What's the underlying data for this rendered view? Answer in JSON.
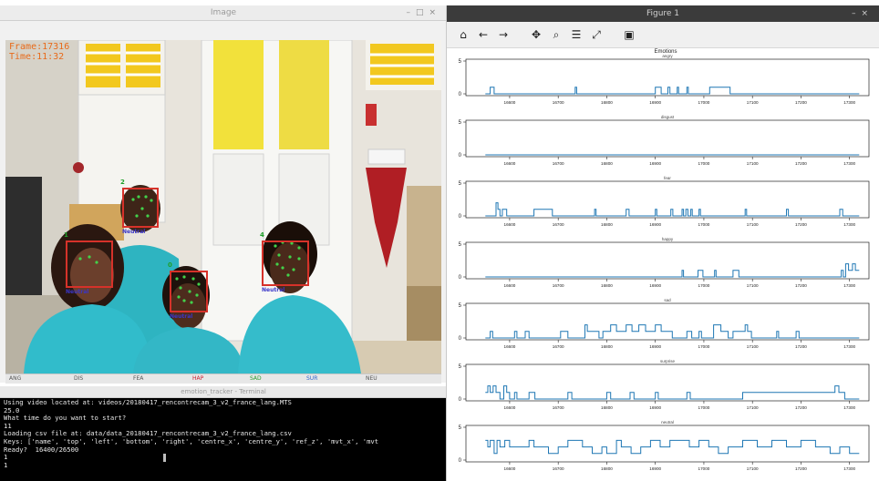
{
  "video_window": {
    "title": "Image",
    "overlay": {
      "frame": "Frame:17316",
      "time": "Time:11:32"
    },
    "face_labels": [
      "Neutral",
      "Neutral",
      "Neutral",
      "Neutral"
    ],
    "face_ids": [
      "2",
      "1",
      "0",
      "4"
    ],
    "trackbar": {
      "labels": [
        "ANG",
        "DIS",
        "FEA",
        "HAP",
        "SAD",
        "SUR",
        "NEU"
      ]
    }
  },
  "terminal_window": {
    "title": "emotion_tracker - Terminal",
    "lines": [
      "Using video located at: videos/20180417_rencontrecam_3_v2_france_lang.MTS",
      "25.0",
      "What time do you want to start?",
      "11",
      "Loading csv file at: data/data_20180417_rencontrecam_3_v2_france_lang.csv",
      "Keys: ['name', 'top', 'left', 'bottom', 'right', 'centre_x', 'centre_y', 'ref_z', 'mvt_x', 'mvt",
      "Ready?  16400/26500",
      "1",
      "1"
    ]
  },
  "figure_window": {
    "title": "Figure 1",
    "toolbar": [
      "home-icon",
      "back-arrow-icon",
      "forward-arrow-icon",
      "pan-icon",
      "zoom-icon",
      "configure-subplots-icon",
      "edit-axis-icon",
      "save-icon"
    ],
    "suptitle": "Emotions"
  },
  "chart_data": {
    "type": "line",
    "title": "Emotions",
    "xlim": [
      16510,
      17340
    ],
    "ylim": [
      0,
      5
    ],
    "yticks": [
      0,
      5
    ],
    "xticks": [
      16600,
      16700,
      16800,
      16900,
      17000,
      17100,
      17200,
      17300
    ],
    "xticklabels": [
      "16600",
      "16700",
      "16800",
      "16900",
      "17000",
      "17100",
      "17200",
      "17300"
    ],
    "series_color": "#1f77b4",
    "x_start": 16550,
    "x_end": 17320,
    "series": [
      {
        "name": "angry",
        "segments": [
          [
            16550,
            16560,
            0
          ],
          [
            16560,
            16568,
            1
          ],
          [
            16568,
            16735,
            0
          ],
          [
            16735,
            16738,
            1
          ],
          [
            16738,
            16900,
            0
          ],
          [
            16900,
            16912,
            1
          ],
          [
            16912,
            16926,
            0
          ],
          [
            16926,
            16930,
            1
          ],
          [
            16930,
            16945,
            0
          ],
          [
            16945,
            16948,
            1
          ],
          [
            16948,
            16965,
            0
          ],
          [
            16965,
            16968,
            1
          ],
          [
            16968,
            17012,
            0
          ],
          [
            17012,
            17054,
            1
          ],
          [
            17054,
            17320,
            0
          ]
        ]
      },
      {
        "name": "disgust",
        "segments": [
          [
            16550,
            17320,
            0
          ]
        ]
      },
      {
        "name": "fear",
        "segments": [
          [
            16550,
            16572,
            0
          ],
          [
            16572,
            16576,
            2
          ],
          [
            16576,
            16580,
            1
          ],
          [
            16580,
            16585,
            0
          ],
          [
            16585,
            16594,
            1
          ],
          [
            16594,
            16650,
            0
          ],
          [
            16650,
            16688,
            1
          ],
          [
            16688,
            16775,
            0
          ],
          [
            16775,
            16778,
            1
          ],
          [
            16778,
            16840,
            0
          ],
          [
            16840,
            16846,
            1
          ],
          [
            16846,
            16900,
            0
          ],
          [
            16900,
            16903,
            1
          ],
          [
            16903,
            16932,
            0
          ],
          [
            16932,
            16936,
            1
          ],
          [
            16936,
            16955,
            0
          ],
          [
            16955,
            16958,
            1
          ],
          [
            16958,
            16963,
            0
          ],
          [
            16963,
            16967,
            1
          ],
          [
            16967,
            16973,
            0
          ],
          [
            16973,
            16976,
            1
          ],
          [
            16976,
            16990,
            0
          ],
          [
            16990,
            16993,
            1
          ],
          [
            16993,
            17085,
            0
          ],
          [
            17085,
            17088,
            1
          ],
          [
            17088,
            17170,
            0
          ],
          [
            17170,
            17174,
            1
          ],
          [
            17174,
            17280,
            0
          ],
          [
            17280,
            17286,
            1
          ],
          [
            17286,
            17320,
            0
          ]
        ]
      },
      {
        "name": "happy",
        "segments": [
          [
            16550,
            16955,
            0
          ],
          [
            16955,
            16958,
            1
          ],
          [
            16958,
            16988,
            0
          ],
          [
            16988,
            16998,
            1
          ],
          [
            16998,
            17022,
            0
          ],
          [
            17022,
            17025,
            1
          ],
          [
            17025,
            17060,
            0
          ],
          [
            17060,
            17072,
            1
          ],
          [
            17072,
            17283,
            0
          ],
          [
            17283,
            17287,
            1
          ],
          [
            17287,
            17292,
            0
          ],
          [
            17292,
            17298,
            2
          ],
          [
            17298,
            17306,
            1
          ],
          [
            17306,
            17312,
            2
          ],
          [
            17312,
            17320,
            1
          ]
        ]
      },
      {
        "name": "sad",
        "segments": [
          [
            16550,
            16560,
            0
          ],
          [
            16560,
            16565,
            1
          ],
          [
            16565,
            16610,
            0
          ],
          [
            16610,
            16615,
            1
          ],
          [
            16615,
            16632,
            0
          ],
          [
            16632,
            16640,
            1
          ],
          [
            16640,
            16705,
            0
          ],
          [
            16705,
            16720,
            1
          ],
          [
            16720,
            16755,
            0
          ],
          [
            16755,
            16760,
            2
          ],
          [
            16760,
            16784,
            1
          ],
          [
            16784,
            16792,
            0
          ],
          [
            16792,
            16808,
            1
          ],
          [
            16808,
            16820,
            2
          ],
          [
            16820,
            16840,
            1
          ],
          [
            16840,
            16852,
            2
          ],
          [
            16852,
            16866,
            1
          ],
          [
            16866,
            16880,
            2
          ],
          [
            16880,
            16900,
            1
          ],
          [
            16900,
            16912,
            2
          ],
          [
            16912,
            16935,
            1
          ],
          [
            16935,
            16965,
            0
          ],
          [
            16965,
            16975,
            1
          ],
          [
            16975,
            16990,
            0
          ],
          [
            16990,
            16995,
            1
          ],
          [
            16995,
            17020,
            0
          ],
          [
            17020,
            17035,
            2
          ],
          [
            17035,
            17050,
            1
          ],
          [
            17050,
            17060,
            0
          ],
          [
            17060,
            17085,
            1
          ],
          [
            17085,
            17090,
            2
          ],
          [
            17090,
            17098,
            1
          ],
          [
            17098,
            17150,
            0
          ],
          [
            17150,
            17154,
            1
          ],
          [
            17154,
            17190,
            0
          ],
          [
            17190,
            17196,
            1
          ],
          [
            17196,
            17320,
            0
          ]
        ]
      },
      {
        "name": "surprise",
        "segments": [
          [
            16550,
            16555,
            1
          ],
          [
            16555,
            16560,
            2
          ],
          [
            16560,
            16566,
            1
          ],
          [
            16566,
            16572,
            2
          ],
          [
            16572,
            16580,
            1
          ],
          [
            16580,
            16588,
            0
          ],
          [
            16588,
            16594,
            2
          ],
          [
            16594,
            16600,
            1
          ],
          [
            16600,
            16610,
            0
          ],
          [
            16610,
            16615,
            1
          ],
          [
            16615,
            16640,
            0
          ],
          [
            16640,
            16652,
            1
          ],
          [
            16652,
            16720,
            0
          ],
          [
            16720,
            16728,
            1
          ],
          [
            16728,
            16800,
            0
          ],
          [
            16800,
            16808,
            1
          ],
          [
            16808,
            16848,
            0
          ],
          [
            16848,
            16856,
            1
          ],
          [
            16856,
            16900,
            0
          ],
          [
            16900,
            16906,
            1
          ],
          [
            16906,
            16965,
            0
          ],
          [
            16965,
            16972,
            1
          ],
          [
            16972,
            17080,
            0
          ],
          [
            17080,
            17085,
            1
          ],
          [
            17085,
            17270,
            1
          ],
          [
            17270,
            17278,
            2
          ],
          [
            17278,
            17290,
            1
          ],
          [
            17290,
            17320,
            0
          ]
        ]
      },
      {
        "name": "neutral",
        "segments": [
          [
            16550,
            16555,
            3
          ],
          [
            16555,
            16560,
            2
          ],
          [
            16560,
            16568,
            3
          ],
          [
            16568,
            16574,
            1
          ],
          [
            16574,
            16580,
            3
          ],
          [
            16580,
            16590,
            2
          ],
          [
            16590,
            16600,
            3
          ],
          [
            16600,
            16640,
            2
          ],
          [
            16640,
            16650,
            3
          ],
          [
            16650,
            16680,
            2
          ],
          [
            16680,
            16700,
            1
          ],
          [
            16700,
            16720,
            2
          ],
          [
            16720,
            16750,
            3
          ],
          [
            16750,
            16770,
            2
          ],
          [
            16770,
            16790,
            1
          ],
          [
            16790,
            16800,
            2
          ],
          [
            16800,
            16820,
            1
          ],
          [
            16820,
            16830,
            3
          ],
          [
            16830,
            16850,
            2
          ],
          [
            16850,
            16870,
            1
          ],
          [
            16870,
            16890,
            2
          ],
          [
            16890,
            16910,
            3
          ],
          [
            16910,
            16930,
            2
          ],
          [
            16930,
            16950,
            3
          ],
          [
            16950,
            16970,
            3
          ],
          [
            16970,
            16990,
            2
          ],
          [
            16990,
            17010,
            3
          ],
          [
            17010,
            17030,
            2
          ],
          [
            17030,
            17050,
            1
          ],
          [
            17050,
            17080,
            2
          ],
          [
            17080,
            17110,
            3
          ],
          [
            17110,
            17140,
            2
          ],
          [
            17140,
            17170,
            3
          ],
          [
            17170,
            17200,
            2
          ],
          [
            17200,
            17230,
            3
          ],
          [
            17230,
            17260,
            2
          ],
          [
            17260,
            17280,
            1
          ],
          [
            17280,
            17300,
            2
          ],
          [
            17300,
            17320,
            1
          ]
        ]
      }
    ]
  }
}
